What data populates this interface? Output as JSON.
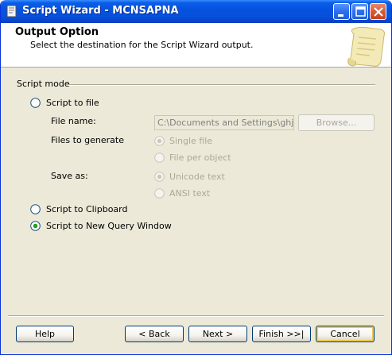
{
  "window": {
    "title": "Script Wizard - MCNSAPNA",
    "accent": "#0a5ee8"
  },
  "header": {
    "title": "Output Option",
    "subtitle": "Select the destination for the Script Wizard output."
  },
  "script_mode": {
    "group_label": "Script mode",
    "options": {
      "to_file": {
        "label": "Script to file",
        "checked": false
      },
      "to_clipboard": {
        "label": "Script to Clipboard",
        "checked": false
      },
      "to_query_window": {
        "label": "Script to New Query Window",
        "checked": true
      }
    },
    "file_name": {
      "label": "File name:",
      "value": "C:\\Documents and Settings\\ghjk\\M",
      "browse_label": "Browse..."
    },
    "files_to_generate": {
      "label": "Files to generate",
      "single_file": "Single file",
      "file_per_object": "File per object"
    },
    "save_as": {
      "label": "Save as:",
      "unicode": "Unicode text",
      "ansi": "ANSI text"
    }
  },
  "footer": {
    "help": "Help",
    "back": "< Back",
    "next": "Next >",
    "finish": "Finish >>|",
    "cancel": "Cancel"
  },
  "icons": {
    "title": "wizard-window-icon",
    "minimize": "minimize-icon",
    "maximize": "maximize-icon",
    "close": "close-icon",
    "header_art": "scroll-paper-icon"
  }
}
